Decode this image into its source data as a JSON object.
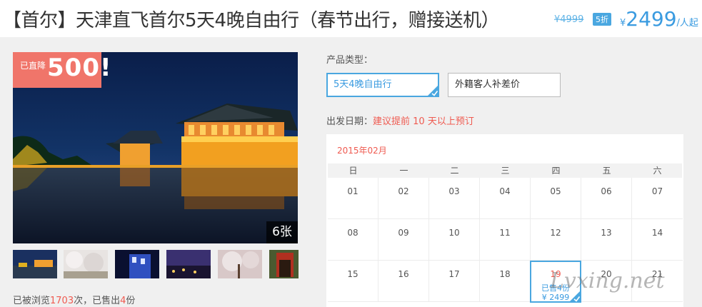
{
  "header": {
    "title": "【首尔】天津直飞首尔5天4晚自由行（春节出行，赠接送机）",
    "original_price": "¥4999",
    "discount": "5折",
    "currency": "¥",
    "price": "2499",
    "unit": "/人起"
  },
  "gallery": {
    "badge_small": "已直降",
    "badge_amount": "500!",
    "photo_count": "6张",
    "thumbnails": [
      "night-palace-thumb",
      "cherry-blossom-thumb",
      "night-street-thumb",
      "city-night-thumb",
      "cherry-tree-thumb",
      "temple-gate-thumb"
    ]
  },
  "stats": {
    "views_prefix": "已被浏览",
    "views": "1703",
    "views_suffix": "次，已售出",
    "sold": "4",
    "sold_suffix": "份"
  },
  "product_type": {
    "label": "产品类型：",
    "options": [
      "5天4晚自由行",
      "外籍客人补差价"
    ],
    "selected": "5天4晚自由行"
  },
  "departure": {
    "label": "出发日期：",
    "note": "建议提前 10 天以上预订"
  },
  "calendar": {
    "month": "2015年02月",
    "weekdays": [
      "日",
      "一",
      "二",
      "三",
      "四",
      "五",
      "六"
    ],
    "weeks": [
      [
        "01",
        "02",
        "03",
        "04",
        "05",
        "06",
        "07"
      ],
      [
        "08",
        "09",
        "10",
        "11",
        "12",
        "13",
        "14"
      ],
      [
        "15",
        "16",
        "17",
        "18",
        "19",
        "20",
        "21"
      ]
    ],
    "selected_day": "19",
    "selected_sold": "已售4份",
    "selected_price": "¥ 2499"
  },
  "watermark": "Lvxing.net",
  "colors": {
    "accent_blue": "#4aa7e0",
    "accent_red": "#ef5a50",
    "badge_bg": "#f0756a"
  }
}
